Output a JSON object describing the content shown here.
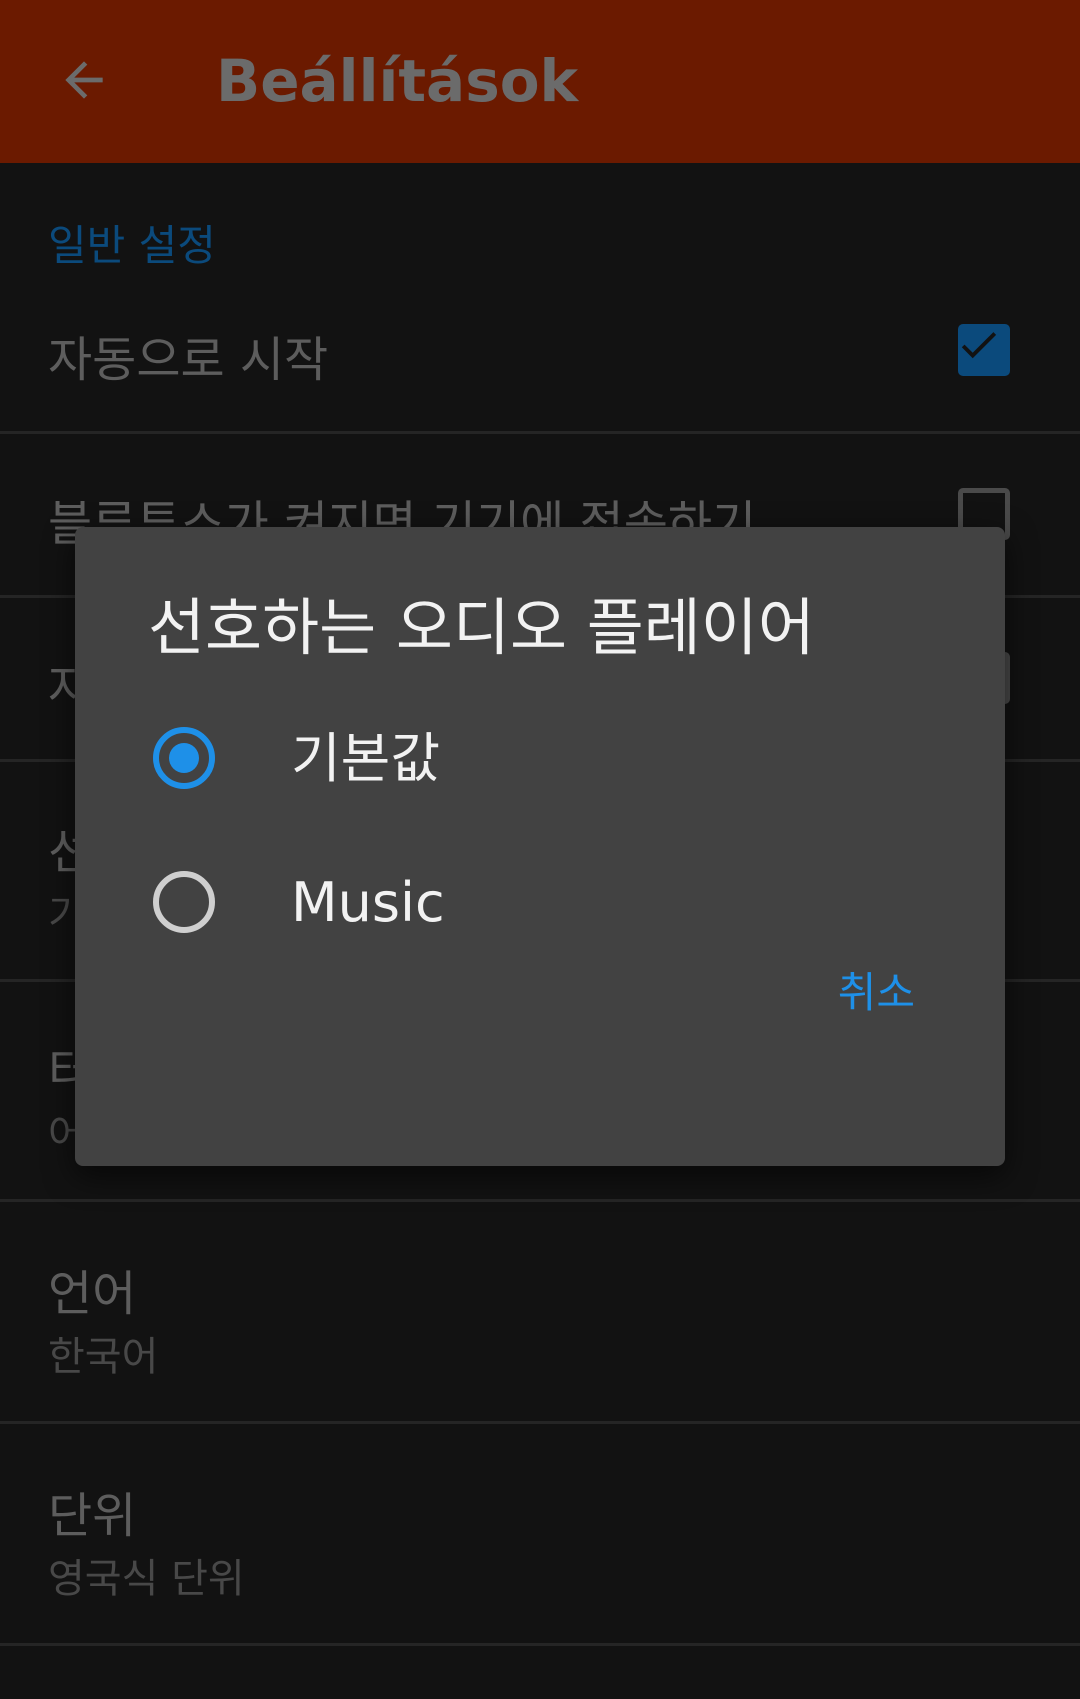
{
  "app_bar": {
    "title": "Beállítások",
    "back_icon": "arrow-left-icon"
  },
  "settings": {
    "section_general": "일반 설정",
    "auto_start": {
      "title": "자동으로 시작",
      "checked": true
    },
    "connect_bt": {
      "title": "블루투스가 켜지면 기기에 접속하기",
      "checked": false
    },
    "row3": {
      "title": "자",
      "checked": false
    },
    "row4": {
      "title": "선",
      "summary": "기"
    },
    "row5": {
      "title": "터",
      "summary": "어"
    },
    "language": {
      "title": "언어",
      "summary": "한국어"
    },
    "units": {
      "title": "단위",
      "summary": "영국식 단위"
    }
  },
  "dialog": {
    "title": "선호하는 오디오 플레이어",
    "options": [
      {
        "label": "기본값",
        "selected": true
      },
      {
        "label": "Music",
        "selected": false
      }
    ],
    "cancel_label": "취소"
  },
  "colors": {
    "app_bar": "#6b1a00",
    "accent": "#1e90e8",
    "background": "#121212",
    "dialog": "#424242"
  }
}
